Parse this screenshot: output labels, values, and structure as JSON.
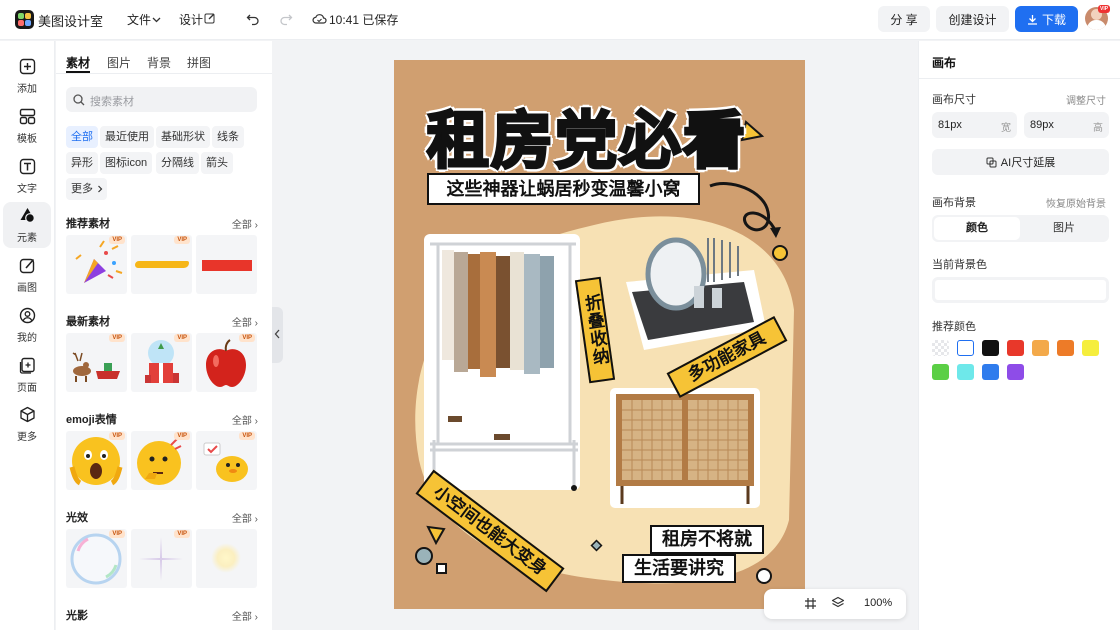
{
  "header": {
    "brand": "美图设计室",
    "file_menu": "文件",
    "design_menu": "设计",
    "save_status": "10:41 已保存",
    "share_label": "分 享",
    "create_label": "创建设计",
    "download_label": "下载",
    "avatar_badge": "VIP"
  },
  "left_nav": [
    {
      "label": "添加",
      "icon": "plus-square-icon"
    },
    {
      "label": "模板",
      "icon": "template-icon"
    },
    {
      "label": "文字",
      "icon": "text-icon"
    },
    {
      "label": "元素",
      "icon": "shapes-icon"
    },
    {
      "label": "画图",
      "icon": "pen-icon"
    },
    {
      "label": "我的",
      "icon": "user-icon"
    },
    {
      "label": "页面",
      "icon": "page-icon"
    },
    {
      "label": "更多",
      "icon": "cube-icon"
    }
  ],
  "panel": {
    "tabs": [
      "素材",
      "图片",
      "背景",
      "拼图"
    ],
    "search_placeholder": "搜索素材",
    "chips": [
      "全部",
      "最近使用",
      "基础形状",
      "线条",
      "异形",
      "图标icon",
      "分隔线",
      "箭头",
      "更多"
    ],
    "sections": [
      {
        "title": "推荐素材",
        "all": "全部",
        "items": [
          "confetti-popper",
          "yellow-brush-stroke",
          "red-bar"
        ],
        "vip": [
          "VIP",
          "VIP",
          ""
        ]
      },
      {
        "title": "最新素材",
        "all": "全部",
        "items": [
          "reindeer-sleigh",
          "snow-globe-gift",
          "red-apple"
        ],
        "vip": [
          "VIP",
          "VIP",
          "VIP"
        ]
      },
      {
        "title": "emoji表情",
        "all": "全部",
        "items": [
          "shocked-emoji",
          "thinking-emoji",
          "duck-emoji"
        ],
        "vip": [
          "VIP",
          "VIP",
          "VIP"
        ]
      },
      {
        "title": "光效",
        "all": "全部",
        "items": [
          "bubble-glow",
          "star-sparkle",
          "soft-glow"
        ],
        "vip": [
          "VIP",
          "VIP",
          ""
        ]
      },
      {
        "title": "光影",
        "all": "全部"
      }
    ]
  },
  "poster": {
    "title": "租房党必看",
    "subtitle": "这些神器让蜗居秒变温馨小窝",
    "tag_fold": "折叠收纳",
    "tag_multi": "多功能家具",
    "tag_space": "小空间也能大变身",
    "tag_rent1": "租房不将就",
    "tag_rent2": "生活要讲究",
    "colors": {
      "bg": "#d09f70",
      "cream": "#f7e1b4",
      "yellow": "#f6c336",
      "black": "#151515"
    }
  },
  "right_panel": {
    "title": "画布",
    "size_label": "画布尺寸",
    "size_adjust": "调整尺寸",
    "width_value": "81px",
    "width_unit": "宽",
    "height_value": "89px",
    "height_unit": "高",
    "ai_extend": "AI尺寸延展",
    "bg_label": "画布背景",
    "bg_restore": "恢复原始背景",
    "seg_color": "颜色",
    "seg_image": "图片",
    "current_bg": "当前背景色",
    "recommend": "推荐颜色",
    "swatches": [
      "transparent",
      "#ffffff",
      "#111111",
      "#e8382a",
      "#f3a94a",
      "#ed7b28",
      "#f5ee3d",
      "#5bcf45",
      "#6ee8ea",
      "#2f7ced",
      "#8e4ce8"
    ]
  },
  "bottom": {
    "zoom": "100%"
  }
}
